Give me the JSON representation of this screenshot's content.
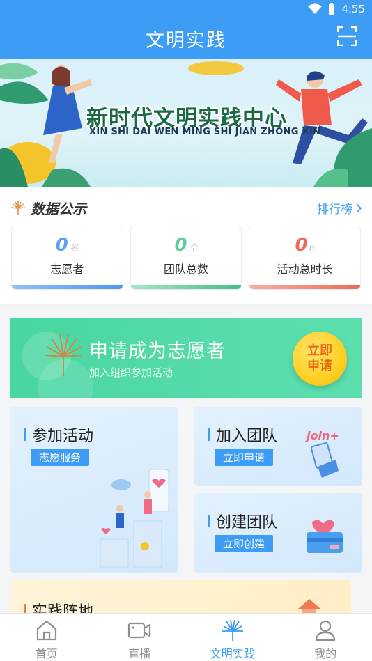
{
  "status": {
    "time": "4:55"
  },
  "header": {
    "title": "文明实践"
  },
  "banner": {
    "title": "新时代文明实践中心",
    "subtitle": "XIN SHI DAI WEN MING SHI JIAN ZHONG XIN"
  },
  "data_section": {
    "title": "数据公示",
    "rank_link": "排行榜",
    "stats": [
      {
        "value": "0",
        "unit": "名",
        "label": "志愿者",
        "color": "#5aa3f1"
      },
      {
        "value": "0",
        "unit": "个",
        "label": "团队总数",
        "color": "#5ccf9e"
      },
      {
        "value": "0",
        "unit": "h",
        "label": "活动总时长",
        "color": "#ef6a5b"
      }
    ]
  },
  "volunteer": {
    "title": "申请成为志愿者",
    "subtitle": "加入组织参加活动",
    "button_line1": "立即",
    "button_line2": "申请"
  },
  "cards": {
    "join_activity": {
      "title": "参加活动",
      "tag": "志愿服务"
    },
    "join_team": {
      "title": "加入团队",
      "tag": "立即申请",
      "art_text": "join+"
    },
    "create_team": {
      "title": "创建团队",
      "tag": "立即创建"
    },
    "practice_base": {
      "title": "实践阵地"
    }
  },
  "tabbar": {
    "items": [
      {
        "label": "首页",
        "icon": "home-icon"
      },
      {
        "label": "直播",
        "icon": "video-icon"
      },
      {
        "label": "文明实践",
        "icon": "civilization-logo-icon"
      },
      {
        "label": "我的",
        "icon": "user-icon"
      }
    ],
    "active_index": 2
  },
  "colors": {
    "primary": "#3d9cf4",
    "volunteer_green": "#48d6a0",
    "button_yellow": "#ffd22a"
  }
}
